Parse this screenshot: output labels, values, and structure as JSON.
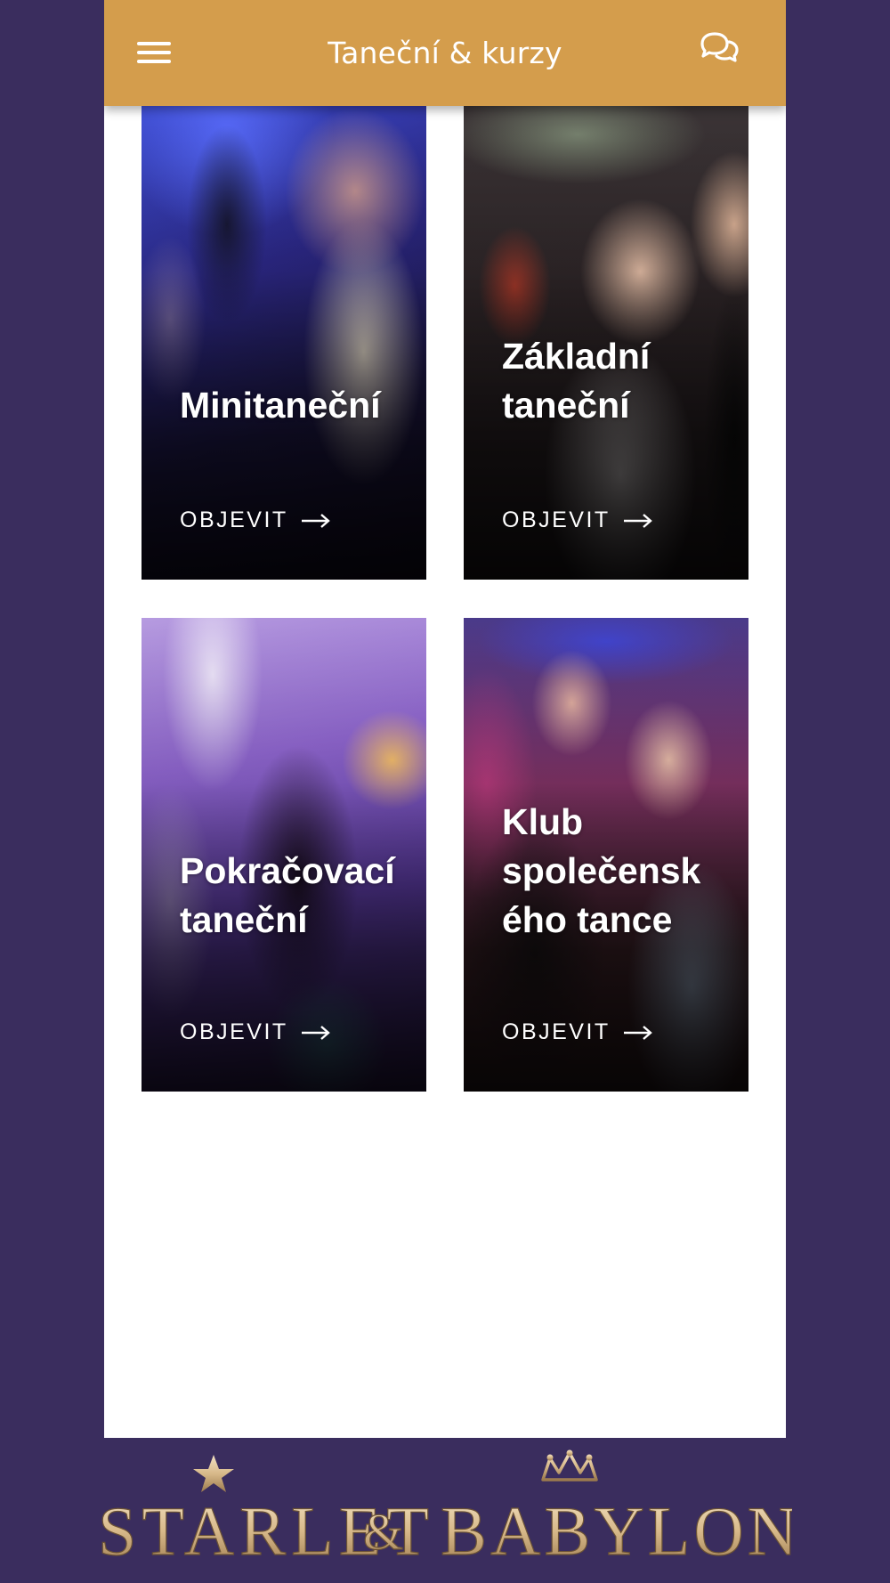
{
  "header": {
    "title": "Taneční & kurzy",
    "menu_icon": "hamburger-menu-icon",
    "chat_icon": "chat-bubbles-icon"
  },
  "courses": [
    {
      "title": "Minitaneční",
      "cta": "OBJEVIT",
      "image_alt": "photo-dancers-blue-light"
    },
    {
      "title": "Základní\ntaneční",
      "cta": "OBJEVIT",
      "image_alt": "photo-couple-starlet-stage"
    },
    {
      "title": "Pokračovací\ntaneční",
      "cta": "OBJEVIT",
      "image_alt": "photo-party-purple-lights"
    },
    {
      "title": "Klub\nspolečensk\ného tance",
      "cta": "OBJEVIT",
      "image_alt": "photo-ballroom-couple"
    }
  ],
  "footer": {
    "logo_text": "STARLET & BABYLON"
  },
  "colors": {
    "background": "#3a2d5e",
    "header": "#d49d4c",
    "panel": "#ffffff",
    "logo_gold": "#d8b98a"
  }
}
